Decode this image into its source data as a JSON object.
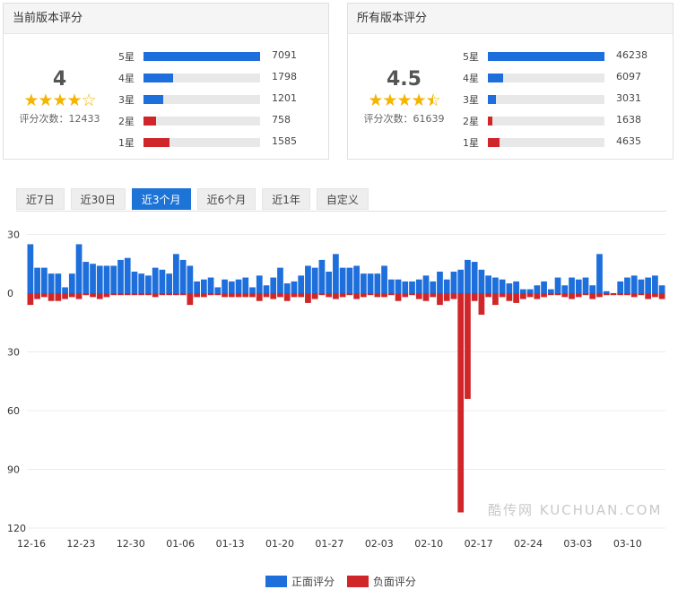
{
  "current": {
    "title": "当前版本评分",
    "score": "4",
    "stars": {
      "full": 4,
      "half": 0,
      "empty": 1
    },
    "count_text": "评分次数：12433",
    "max": 7091,
    "rows": [
      {
        "label": "5星",
        "count": "7091",
        "value": 7091
      },
      {
        "label": "4星",
        "count": "1798",
        "value": 1798
      },
      {
        "label": "3星",
        "count": "1201",
        "value": 1201
      },
      {
        "label": "2星",
        "count": "758",
        "value": 758
      },
      {
        "label": "1星",
        "count": "1585",
        "value": 1585
      }
    ]
  },
  "all": {
    "title": "所有版本评分",
    "score": "4.5",
    "stars": {
      "full": 4,
      "half": 1,
      "empty": 0
    },
    "count_text": "评分次数：61639",
    "max": 46238,
    "rows": [
      {
        "label": "5星",
        "count": "46238",
        "value": 46238
      },
      {
        "label": "4星",
        "count": "6097",
        "value": 6097
      },
      {
        "label": "3星",
        "count": "3031",
        "value": 3031
      },
      {
        "label": "2星",
        "count": "1638",
        "value": 1638
      },
      {
        "label": "1星",
        "count": "4635",
        "value": 4635
      }
    ]
  },
  "colors": {
    "blue": "#1e6fdc",
    "red": "#d0262a",
    "track": "#e8e8e8",
    "star": "#f5b400"
  },
  "tabs": [
    {
      "label": "近7日",
      "active": false
    },
    {
      "label": "近30日",
      "active": false
    },
    {
      "label": "近3个月",
      "active": true
    },
    {
      "label": "近6个月",
      "active": false
    },
    {
      "label": "近1年",
      "active": false
    },
    {
      "label": "自定义",
      "active": false
    }
  ],
  "watermark": "酷传网 KUCHUAN.COM",
  "legend": [
    {
      "label": "正面评分",
      "color": "#1e6fdc"
    },
    {
      "label": "负面评分",
      "color": "#d0262a"
    }
  ],
  "chart_data": {
    "type": "bar",
    "ylim": [
      -120,
      30
    ],
    "y_ticks": [
      30,
      0,
      30,
      60,
      90,
      120
    ],
    "x_ticks": [
      "12-16",
      "12-23",
      "12-30",
      "01-06",
      "01-13",
      "01-20",
      "01-27",
      "02-03",
      "02-10",
      "02-17",
      "02-24",
      "03-03",
      "03-10"
    ],
    "grid": true,
    "legend_position": "bottom",
    "series": [
      {
        "name": "正面评分",
        "values": [
          25,
          13,
          13,
          10,
          10,
          3,
          10,
          25,
          16,
          15,
          14,
          14,
          14,
          17,
          18,
          11,
          10,
          9,
          13,
          12,
          10,
          20,
          17,
          14,
          6,
          7,
          8,
          3,
          7,
          6,
          7,
          8,
          3,
          9,
          4,
          8,
          13,
          5,
          6,
          9,
          14,
          13,
          17,
          11,
          20,
          13,
          13,
          14,
          10,
          10,
          10,
          14,
          7,
          7,
          6,
          6,
          7,
          9,
          6,
          11,
          7,
          11,
          12,
          17,
          16,
          12,
          9,
          8,
          7,
          5,
          6,
          2,
          2,
          4,
          6,
          2,
          8,
          4,
          8,
          7,
          8,
          4,
          20,
          1,
          0,
          6,
          8,
          9,
          7,
          8,
          9,
          4
        ]
      },
      {
        "name": "负面评分",
        "values": [
          -6,
          -3,
          -2,
          -4,
          -4,
          -3,
          -2,
          -3,
          -1,
          -2,
          -3,
          -2,
          -1,
          -1,
          -1,
          -1,
          -1,
          -1,
          -2,
          -1,
          -1,
          -1,
          -1,
          -6,
          -2,
          -2,
          -1,
          -1,
          -2,
          -2,
          -2,
          -2,
          -2,
          -4,
          -2,
          -3,
          -2,
          -4,
          -2,
          -2,
          -5,
          -3,
          -1,
          -2,
          -3,
          -2,
          -1,
          -3,
          -2,
          -1,
          -2,
          -2,
          -1,
          -4,
          -2,
          -1,
          -3,
          -4,
          -2,
          -6,
          -4,
          -3,
          -112,
          -54,
          -4,
          -11,
          -2,
          -6,
          -2,
          -4,
          -5,
          -3,
          -2,
          -3,
          -2,
          -1,
          -1,
          -2,
          -3,
          -2,
          -1,
          -3,
          -2,
          -1,
          -1,
          -1,
          -1,
          -2,
          -1,
          -3,
          -2,
          -3
        ]
      }
    ]
  }
}
